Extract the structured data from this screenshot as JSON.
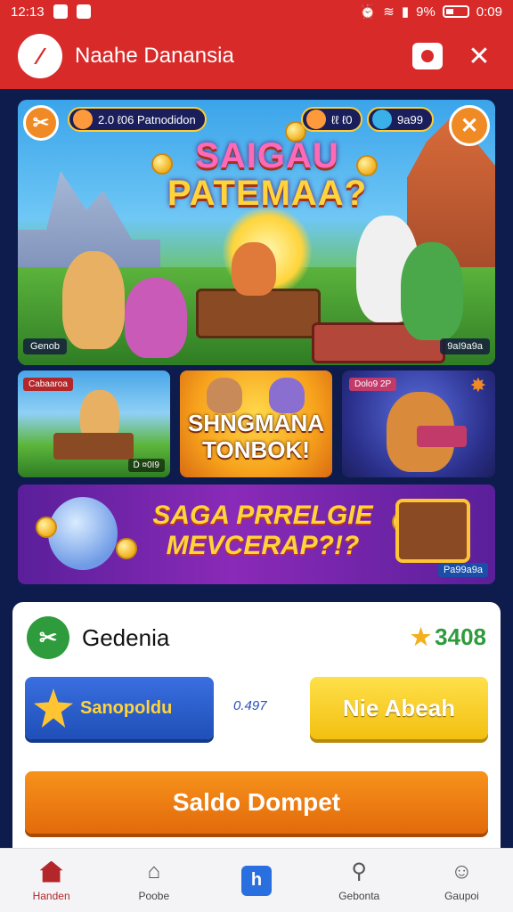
{
  "status_bar": {
    "time": "12:13",
    "battery": "9%",
    "clock_right": "0:09"
  },
  "app": {
    "title": "Naahe Danansia"
  },
  "hero": {
    "title_line1": "SAIGAU",
    "title_line2": "PATEMAA?",
    "pill_left": "2.0 ℓ06 Patnodidon",
    "pill_mid": "ℓℓ ℓ0",
    "pill_right": "9a99",
    "tag_left": "Genob",
    "tag_right": "9aI9a9a"
  },
  "tiles": [
    {
      "badge": "Cabaaroa",
      "footer": "D̈ ¤0I9"
    },
    {
      "title_line1": "SHNGMANA",
      "title_line2": "TONBOK!"
    },
    {
      "badge": "Dolo9 2P",
      "footer": ""
    }
  ],
  "promo": {
    "line1": "SAGA PRRELGIE",
    "line2": "MEVCERAP?!?",
    "tag": "Pa99a9a"
  },
  "card": {
    "title": "Gedenia",
    "score": "3408",
    "blue_button": "Sanopoldu",
    "mid_value": "0.497",
    "yellow_button": "Nie Abeah",
    "orange_button": "Saldo Dompet"
  },
  "nav": [
    {
      "label": "Handen",
      "icon": "home-icon"
    },
    {
      "label": "Poobe",
      "icon": "home-outline-icon"
    },
    {
      "label": "",
      "icon": "app-center-icon"
    },
    {
      "label": "Gebonta",
      "icon": "search-icon"
    },
    {
      "label": "Gaupoi",
      "icon": "profile-icon"
    }
  ]
}
